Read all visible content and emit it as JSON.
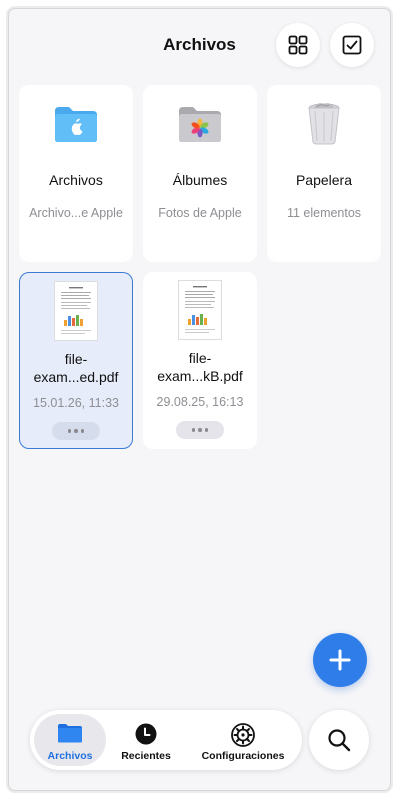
{
  "header": {
    "title": "Archivos"
  },
  "locations": [
    {
      "name": "Archivos",
      "subtitle": "Archivo...e Apple",
      "icon": "icloud-folder-icon"
    },
    {
      "name": "Álbumes",
      "subtitle": "Fotos de Apple",
      "icon": "photos-folder-icon"
    },
    {
      "name": "Papelera",
      "subtitle": "11 elementos",
      "icon": "trash-icon"
    }
  ],
  "files": [
    {
      "name_line1": "file-",
      "name_line2": "exam...ed.pdf",
      "date": "15.01.26, 11:33",
      "selected": true
    },
    {
      "name_line1": "file-",
      "name_line2": "exam...kB.pdf",
      "date": "29.08.25, 16:13",
      "selected": false
    }
  ],
  "tabs": [
    {
      "label": "Archivos",
      "icon": "folder-icon",
      "active": true
    },
    {
      "label": "Recientes",
      "icon": "clock-icon",
      "active": false
    },
    {
      "label": "Configuraciones",
      "icon": "gear-icon",
      "active": false
    }
  ],
  "colors": {
    "accent": "#2f7de9",
    "selected_border": "#3b7bd6",
    "selected_bg": "#e6ecf9",
    "folder": "#5ab8f5"
  }
}
